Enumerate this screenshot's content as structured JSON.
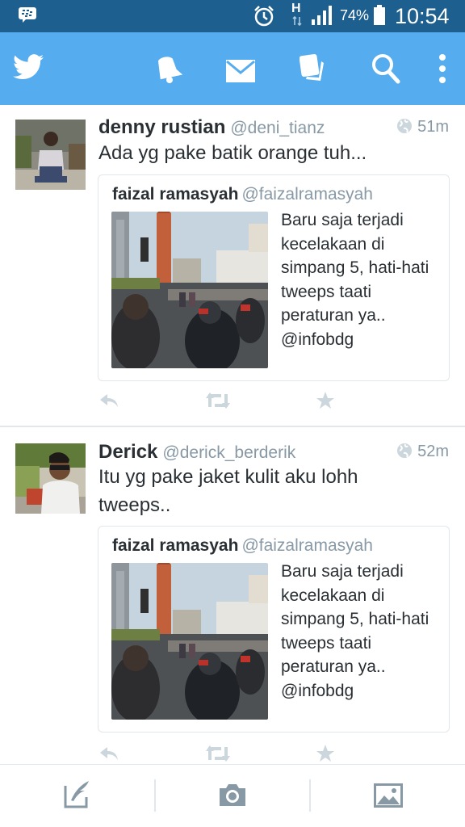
{
  "status_bar": {
    "network": "H",
    "battery_percent": "74%",
    "time": "10:54",
    "icons": [
      "bbm-icon",
      "alarm-icon",
      "hspa-arrows-icon",
      "signal-icon",
      "battery-icon"
    ]
  },
  "action_bar": {
    "icons": [
      "twitter-bird-icon",
      "notifications-bell-icon",
      "messages-envelope-icon",
      "discover-cards-icon",
      "search-icon",
      "overflow-menu-icon"
    ]
  },
  "colors": {
    "status_bar": "#1d5f8f",
    "action_bar": "#55acee",
    "text": "#292f33",
    "muted": "#8899a6",
    "action_icon": "#ccd6dd",
    "border": "#e1e8ed"
  },
  "tweets": [
    {
      "name": "denny rustian",
      "handle": "@deni_tianz",
      "time": "51m",
      "text": "Ada yg pake batik orange tuh...",
      "quote": {
        "name": "faizal ramasyah",
        "handle": "@faizalramasyah",
        "text": "Baru saja terjadi kecelakaan di simpang 5, hati-hati tweeps taati peraturan ya.. @infobdg"
      }
    },
    {
      "name": "Derick",
      "handle": "@derick_berderik",
      "time": "52m",
      "text": "Itu yg pake jaket kulit aku lohh tweeps..",
      "quote": {
        "name": "faizal ramasyah",
        "handle": "@faizalramasyah",
        "text": "Baru saja terjadi kecelakaan di simpang 5, hati-hati tweeps taati peraturan ya.. @infobdg"
      }
    }
  ],
  "tweet_actions": [
    "reply-icon",
    "retweet-icon",
    "favorite-star-icon"
  ],
  "bottom_bar": {
    "icons": [
      "compose-tweet-icon",
      "camera-icon",
      "gallery-image-icon"
    ]
  }
}
